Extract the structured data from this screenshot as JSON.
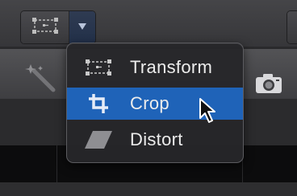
{
  "toolbar": {
    "tool_button_icon": "transform-icon",
    "dropdown_icon": "triangle-down-icon"
  },
  "viewer": {
    "magic_wand_icon": "magic-wand-icon",
    "camera_icon": "camera-icon"
  },
  "menu": {
    "items": [
      {
        "label": "Transform",
        "icon": "transform-icon",
        "selected": false
      },
      {
        "label": "Crop",
        "icon": "crop-icon",
        "selected": true
      },
      {
        "label": "Distort",
        "icon": "distort-icon",
        "selected": false
      }
    ]
  },
  "colors": {
    "accent": "#1f63b8",
    "menu_bg": "#26262a",
    "menu_text": "#ececec"
  }
}
